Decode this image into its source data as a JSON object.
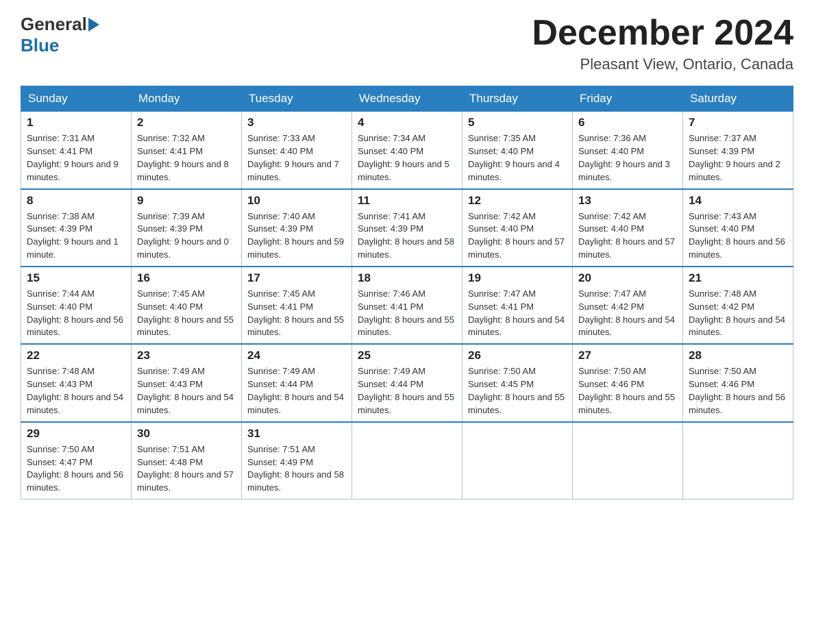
{
  "header": {
    "logo_general": "General",
    "logo_blue": "Blue",
    "month_title": "December 2024",
    "location": "Pleasant View, Ontario, Canada"
  },
  "days_of_week": [
    "Sunday",
    "Monday",
    "Tuesday",
    "Wednesday",
    "Thursday",
    "Friday",
    "Saturday"
  ],
  "weeks": [
    [
      {
        "day": "1",
        "sunrise": "7:31 AM",
        "sunset": "4:41 PM",
        "daylight": "9 hours and 9 minutes."
      },
      {
        "day": "2",
        "sunrise": "7:32 AM",
        "sunset": "4:41 PM",
        "daylight": "9 hours and 8 minutes."
      },
      {
        "day": "3",
        "sunrise": "7:33 AM",
        "sunset": "4:40 PM",
        "daylight": "9 hours and 7 minutes."
      },
      {
        "day": "4",
        "sunrise": "7:34 AM",
        "sunset": "4:40 PM",
        "daylight": "9 hours and 5 minutes."
      },
      {
        "day": "5",
        "sunrise": "7:35 AM",
        "sunset": "4:40 PM",
        "daylight": "9 hours and 4 minutes."
      },
      {
        "day": "6",
        "sunrise": "7:36 AM",
        "sunset": "4:40 PM",
        "daylight": "9 hours and 3 minutes."
      },
      {
        "day": "7",
        "sunrise": "7:37 AM",
        "sunset": "4:39 PM",
        "daylight": "9 hours and 2 minutes."
      }
    ],
    [
      {
        "day": "8",
        "sunrise": "7:38 AM",
        "sunset": "4:39 PM",
        "daylight": "9 hours and 1 minute."
      },
      {
        "day": "9",
        "sunrise": "7:39 AM",
        "sunset": "4:39 PM",
        "daylight": "9 hours and 0 minutes."
      },
      {
        "day": "10",
        "sunrise": "7:40 AM",
        "sunset": "4:39 PM",
        "daylight": "8 hours and 59 minutes."
      },
      {
        "day": "11",
        "sunrise": "7:41 AM",
        "sunset": "4:39 PM",
        "daylight": "8 hours and 58 minutes."
      },
      {
        "day": "12",
        "sunrise": "7:42 AM",
        "sunset": "4:40 PM",
        "daylight": "8 hours and 57 minutes."
      },
      {
        "day": "13",
        "sunrise": "7:42 AM",
        "sunset": "4:40 PM",
        "daylight": "8 hours and 57 minutes."
      },
      {
        "day": "14",
        "sunrise": "7:43 AM",
        "sunset": "4:40 PM",
        "daylight": "8 hours and 56 minutes."
      }
    ],
    [
      {
        "day": "15",
        "sunrise": "7:44 AM",
        "sunset": "4:40 PM",
        "daylight": "8 hours and 56 minutes."
      },
      {
        "day": "16",
        "sunrise": "7:45 AM",
        "sunset": "4:40 PM",
        "daylight": "8 hours and 55 minutes."
      },
      {
        "day": "17",
        "sunrise": "7:45 AM",
        "sunset": "4:41 PM",
        "daylight": "8 hours and 55 minutes."
      },
      {
        "day": "18",
        "sunrise": "7:46 AM",
        "sunset": "4:41 PM",
        "daylight": "8 hours and 55 minutes."
      },
      {
        "day": "19",
        "sunrise": "7:47 AM",
        "sunset": "4:41 PM",
        "daylight": "8 hours and 54 minutes."
      },
      {
        "day": "20",
        "sunrise": "7:47 AM",
        "sunset": "4:42 PM",
        "daylight": "8 hours and 54 minutes."
      },
      {
        "day": "21",
        "sunrise": "7:48 AM",
        "sunset": "4:42 PM",
        "daylight": "8 hours and 54 minutes."
      }
    ],
    [
      {
        "day": "22",
        "sunrise": "7:48 AM",
        "sunset": "4:43 PM",
        "daylight": "8 hours and 54 minutes."
      },
      {
        "day": "23",
        "sunrise": "7:49 AM",
        "sunset": "4:43 PM",
        "daylight": "8 hours and 54 minutes."
      },
      {
        "day": "24",
        "sunrise": "7:49 AM",
        "sunset": "4:44 PM",
        "daylight": "8 hours and 54 minutes."
      },
      {
        "day": "25",
        "sunrise": "7:49 AM",
        "sunset": "4:44 PM",
        "daylight": "8 hours and 55 minutes."
      },
      {
        "day": "26",
        "sunrise": "7:50 AM",
        "sunset": "4:45 PM",
        "daylight": "8 hours and 55 minutes."
      },
      {
        "day": "27",
        "sunrise": "7:50 AM",
        "sunset": "4:46 PM",
        "daylight": "8 hours and 55 minutes."
      },
      {
        "day": "28",
        "sunrise": "7:50 AM",
        "sunset": "4:46 PM",
        "daylight": "8 hours and 56 minutes."
      }
    ],
    [
      {
        "day": "29",
        "sunrise": "7:50 AM",
        "sunset": "4:47 PM",
        "daylight": "8 hours and 56 minutes."
      },
      {
        "day": "30",
        "sunrise": "7:51 AM",
        "sunset": "4:48 PM",
        "daylight": "8 hours and 57 minutes."
      },
      {
        "day": "31",
        "sunrise": "7:51 AM",
        "sunset": "4:49 PM",
        "daylight": "8 hours and 58 minutes."
      },
      null,
      null,
      null,
      null
    ]
  ]
}
